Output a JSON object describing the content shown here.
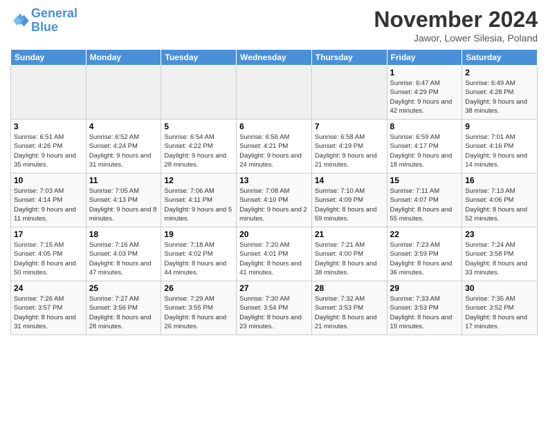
{
  "logo": {
    "text_general": "General",
    "text_blue": "Blue"
  },
  "title": "November 2024",
  "subtitle": "Jawor, Lower Silesia, Poland",
  "days_of_week": [
    "Sunday",
    "Monday",
    "Tuesday",
    "Wednesday",
    "Thursday",
    "Friday",
    "Saturday"
  ],
  "weeks": [
    [
      {
        "day": "",
        "info": ""
      },
      {
        "day": "",
        "info": ""
      },
      {
        "day": "",
        "info": ""
      },
      {
        "day": "",
        "info": ""
      },
      {
        "day": "",
        "info": ""
      },
      {
        "day": "1",
        "info": "Sunrise: 6:47 AM\nSunset: 4:29 PM\nDaylight: 9 hours\nand 42 minutes."
      },
      {
        "day": "2",
        "info": "Sunrise: 6:49 AM\nSunset: 4:28 PM\nDaylight: 9 hours\nand 38 minutes."
      }
    ],
    [
      {
        "day": "3",
        "info": "Sunrise: 6:51 AM\nSunset: 4:26 PM\nDaylight: 9 hours\nand 35 minutes."
      },
      {
        "day": "4",
        "info": "Sunrise: 6:52 AM\nSunset: 4:24 PM\nDaylight: 9 hours\nand 31 minutes."
      },
      {
        "day": "5",
        "info": "Sunrise: 6:54 AM\nSunset: 4:22 PM\nDaylight: 9 hours\nand 28 minutes."
      },
      {
        "day": "6",
        "info": "Sunrise: 6:56 AM\nSunset: 4:21 PM\nDaylight: 9 hours\nand 24 minutes."
      },
      {
        "day": "7",
        "info": "Sunrise: 6:58 AM\nSunset: 4:19 PM\nDaylight: 9 hours\nand 21 minutes."
      },
      {
        "day": "8",
        "info": "Sunrise: 6:59 AM\nSunset: 4:17 PM\nDaylight: 9 hours\nand 18 minutes."
      },
      {
        "day": "9",
        "info": "Sunrise: 7:01 AM\nSunset: 4:16 PM\nDaylight: 9 hours\nand 14 minutes."
      }
    ],
    [
      {
        "day": "10",
        "info": "Sunrise: 7:03 AM\nSunset: 4:14 PM\nDaylight: 9 hours\nand 11 minutes."
      },
      {
        "day": "11",
        "info": "Sunrise: 7:05 AM\nSunset: 4:13 PM\nDaylight: 9 hours\nand 8 minutes."
      },
      {
        "day": "12",
        "info": "Sunrise: 7:06 AM\nSunset: 4:11 PM\nDaylight: 9 hours\nand 5 minutes."
      },
      {
        "day": "13",
        "info": "Sunrise: 7:08 AM\nSunset: 4:10 PM\nDaylight: 9 hours\nand 2 minutes."
      },
      {
        "day": "14",
        "info": "Sunrise: 7:10 AM\nSunset: 4:09 PM\nDaylight: 8 hours\nand 59 minutes."
      },
      {
        "day": "15",
        "info": "Sunrise: 7:11 AM\nSunset: 4:07 PM\nDaylight: 8 hours\nand 55 minutes."
      },
      {
        "day": "16",
        "info": "Sunrise: 7:13 AM\nSunset: 4:06 PM\nDaylight: 8 hours\nand 52 minutes."
      }
    ],
    [
      {
        "day": "17",
        "info": "Sunrise: 7:15 AM\nSunset: 4:05 PM\nDaylight: 8 hours\nand 50 minutes."
      },
      {
        "day": "18",
        "info": "Sunrise: 7:16 AM\nSunset: 4:03 PM\nDaylight: 8 hours\nand 47 minutes."
      },
      {
        "day": "19",
        "info": "Sunrise: 7:18 AM\nSunset: 4:02 PM\nDaylight: 8 hours\nand 44 minutes."
      },
      {
        "day": "20",
        "info": "Sunrise: 7:20 AM\nSunset: 4:01 PM\nDaylight: 8 hours\nand 41 minutes."
      },
      {
        "day": "21",
        "info": "Sunrise: 7:21 AM\nSunset: 4:00 PM\nDaylight: 8 hours\nand 38 minutes."
      },
      {
        "day": "22",
        "info": "Sunrise: 7:23 AM\nSunset: 3:59 PM\nDaylight: 8 hours\nand 36 minutes."
      },
      {
        "day": "23",
        "info": "Sunrise: 7:24 AM\nSunset: 3:58 PM\nDaylight: 8 hours\nand 33 minutes."
      }
    ],
    [
      {
        "day": "24",
        "info": "Sunrise: 7:26 AM\nSunset: 3:57 PM\nDaylight: 8 hours\nand 31 minutes."
      },
      {
        "day": "25",
        "info": "Sunrise: 7:27 AM\nSunset: 3:56 PM\nDaylight: 8 hours\nand 28 minutes."
      },
      {
        "day": "26",
        "info": "Sunrise: 7:29 AM\nSunset: 3:55 PM\nDaylight: 8 hours\nand 26 minutes."
      },
      {
        "day": "27",
        "info": "Sunrise: 7:30 AM\nSunset: 3:54 PM\nDaylight: 8 hours\nand 23 minutes."
      },
      {
        "day": "28",
        "info": "Sunrise: 7:32 AM\nSunset: 3:53 PM\nDaylight: 8 hours\nand 21 minutes."
      },
      {
        "day": "29",
        "info": "Sunrise: 7:33 AM\nSunset: 3:53 PM\nDaylight: 8 hours\nand 19 minutes."
      },
      {
        "day": "30",
        "info": "Sunrise: 7:35 AM\nSunset: 3:52 PM\nDaylight: 8 hours\nand 17 minutes."
      }
    ]
  ]
}
